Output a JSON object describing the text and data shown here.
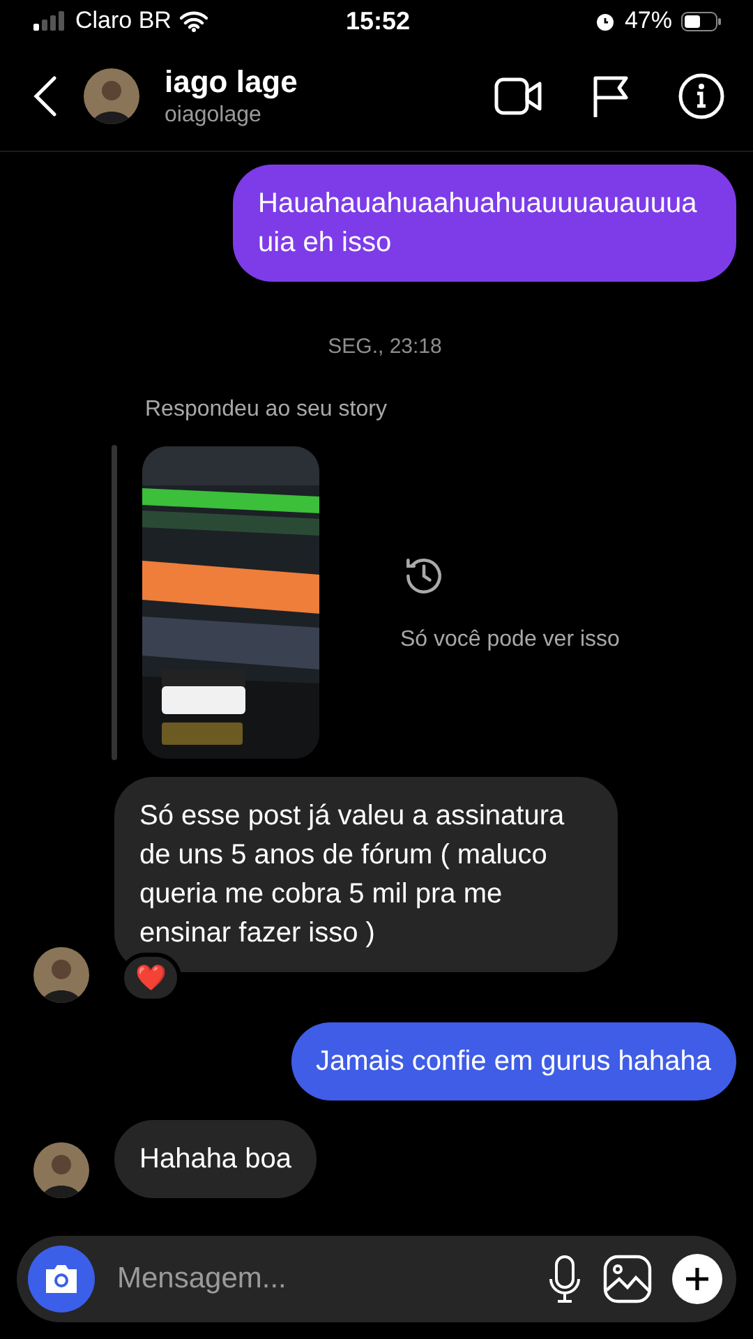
{
  "status_bar": {
    "carrier": "Claro BR",
    "time": "15:52",
    "battery": "47%"
  },
  "header": {
    "name": "iago lage",
    "username": "oiagolage"
  },
  "messages": [
    {
      "kind": "outgoing",
      "text": "Hauahauahuaahuahuauuuauauuua uia eh isso",
      "color": "#7d3ce8"
    },
    {
      "kind": "date",
      "text": "SEG., 23:18"
    },
    {
      "kind": "story",
      "label": "Respondeu ao seu story",
      "note": "Só você pode ver isso"
    },
    {
      "kind": "incoming",
      "text": "Só esse post já valeu a assinatura de uns 5 anos de fórum ( maluco queria me cobra 5 mil pra me ensinar fazer isso )",
      "avatar": true,
      "reaction": "❤️"
    },
    {
      "kind": "outgoing",
      "text": "Jamais confie em gurus hahaha",
      "color": "#3f5de6"
    },
    {
      "kind": "incoming",
      "text": "Hahaha boa",
      "avatar": true
    }
  ],
  "composer": {
    "placeholder": "Mensagem..."
  }
}
